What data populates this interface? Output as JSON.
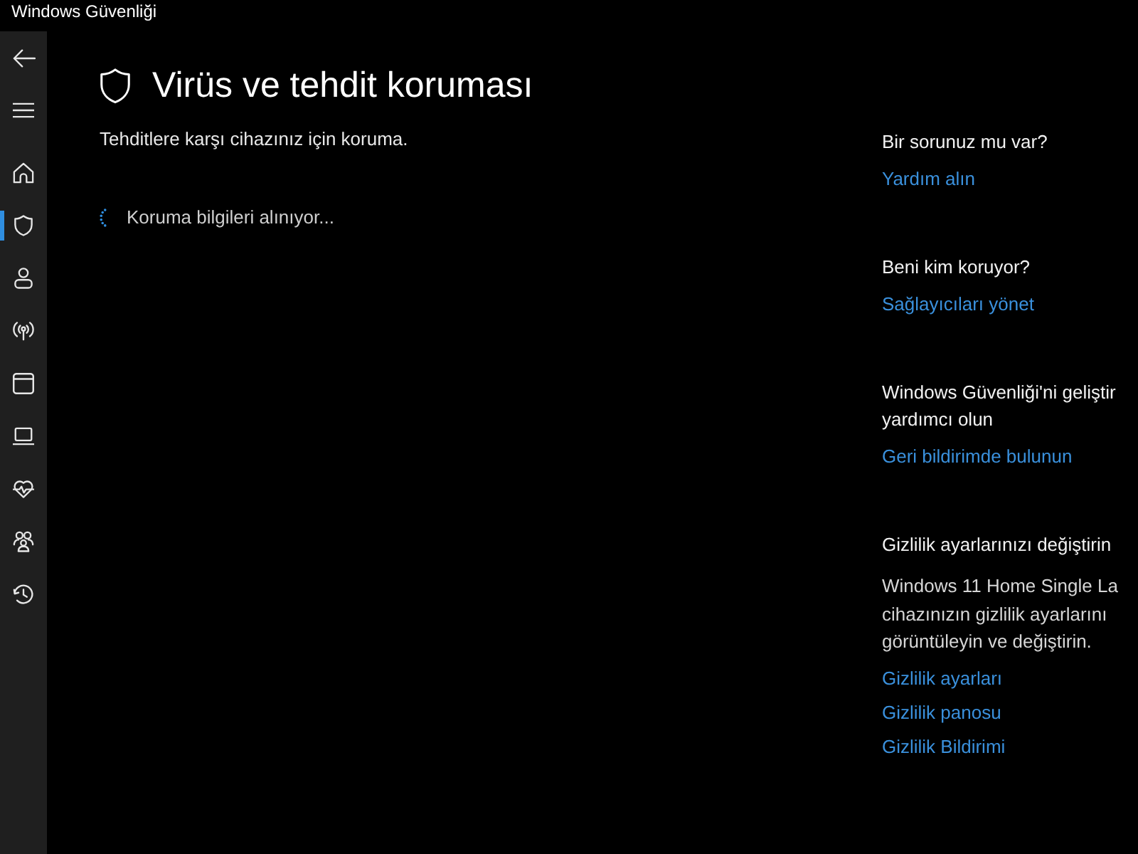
{
  "window": {
    "title": "Windows Güvenliği"
  },
  "sidebar": {
    "items": [
      {
        "selected": false
      },
      {
        "selected": true
      },
      {
        "selected": false
      },
      {
        "selected": false
      },
      {
        "selected": false
      },
      {
        "selected": false
      },
      {
        "selected": false
      },
      {
        "selected": false
      },
      {
        "selected": false
      }
    ]
  },
  "page": {
    "title": "Virüs ve tehdit koruması",
    "subtitle": "Tehditlere karşı cihazınız için koruma.",
    "status": "Koruma bilgileri alınıyor..."
  },
  "side_panel": {
    "sections": [
      {
        "heading": [
          "Bir sorunuz mu var?"
        ],
        "links": [
          "Yardım alın"
        ]
      },
      {
        "heading": [
          "Beni kim koruyor?"
        ],
        "links": [
          "Sağlayıcıları yönet"
        ]
      },
      {
        "heading": [
          "Windows Güvenliği'ni geliştir",
          "yardımcı olun"
        ],
        "links": [
          "Geri bildirimde bulunun"
        ]
      },
      {
        "heading": [
          "Gizlilik ayarlarınızı değiştirin"
        ],
        "description": [
          "Windows 11 Home Single La",
          "cihazınızın gizlilik ayarlarını",
          "görüntüleyin ve değiştirin."
        ],
        "links": [
          "Gizlilik ayarları",
          "Gizlilik panosu",
          "Gizlilik Bildirimi"
        ]
      }
    ]
  }
}
